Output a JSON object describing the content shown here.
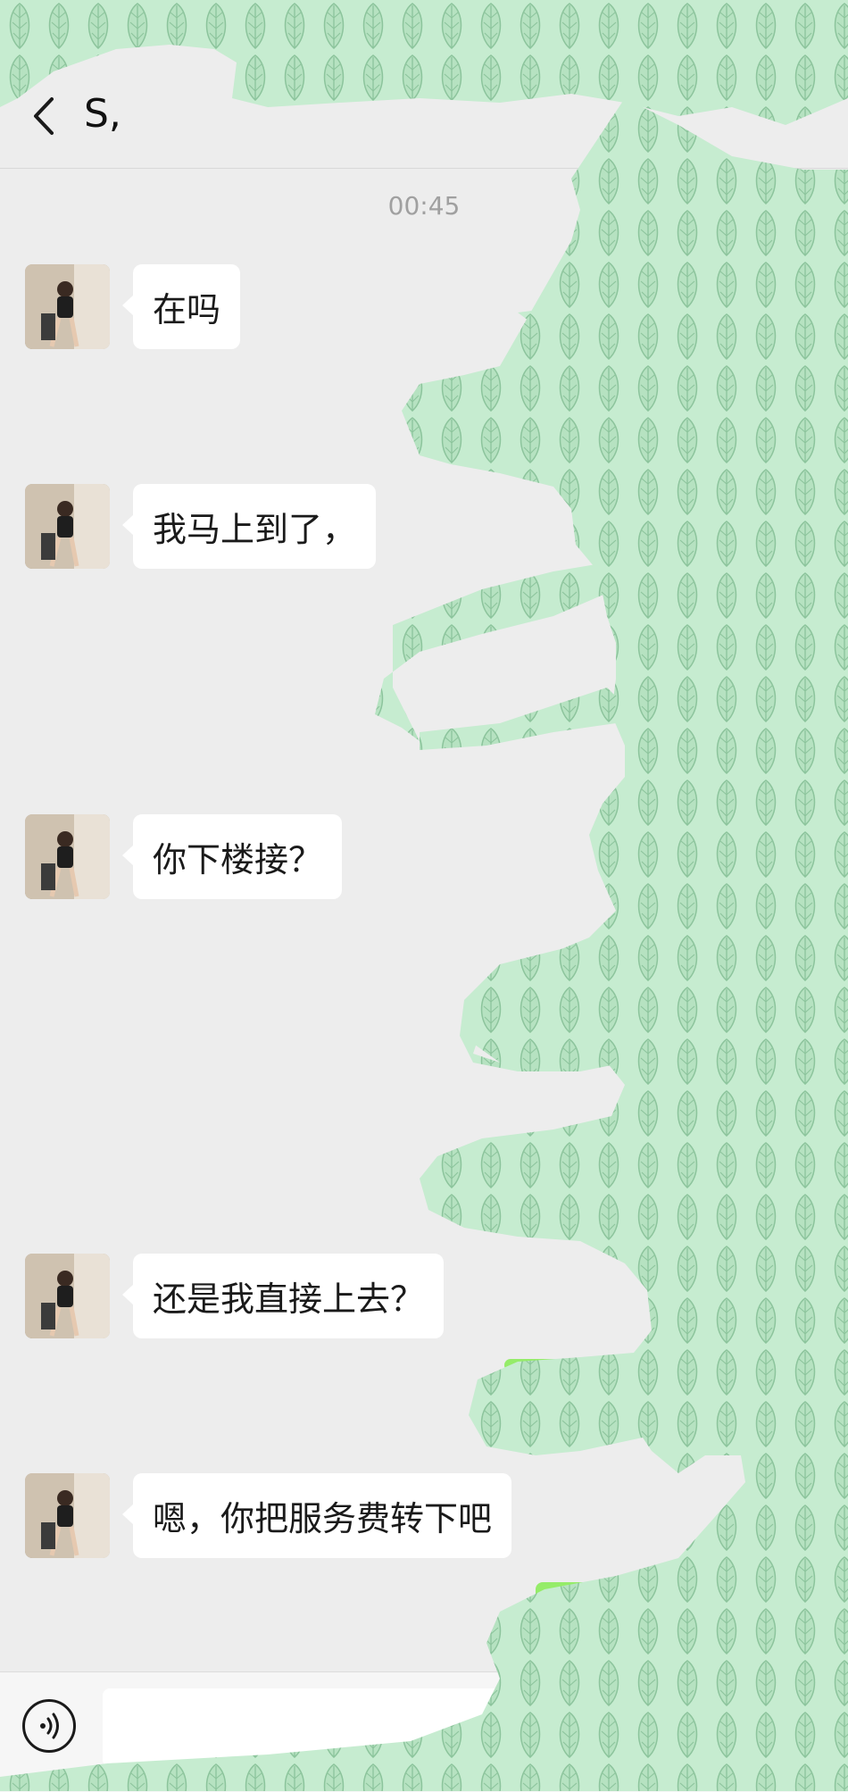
{
  "header": {
    "title": "S,"
  },
  "chat": {
    "timestamp": "00:45",
    "messages": [
      {
        "text": "在吗"
      },
      {
        "text": "我马上到了，"
      },
      {
        "text": "你下楼接？"
      },
      {
        "text": "还是我直接上去？"
      },
      {
        "text": "嗯，你把服务费转下吧"
      }
    ]
  },
  "colors": {
    "background": "#ededed",
    "bubble_in": "#ffffff",
    "bubble_out": "#95ec69",
    "redaction": "#bfe6c8"
  },
  "icons": {
    "back": "chevron-left-icon",
    "voice": "voice-icon",
    "plus": "plus-circle-icon"
  }
}
